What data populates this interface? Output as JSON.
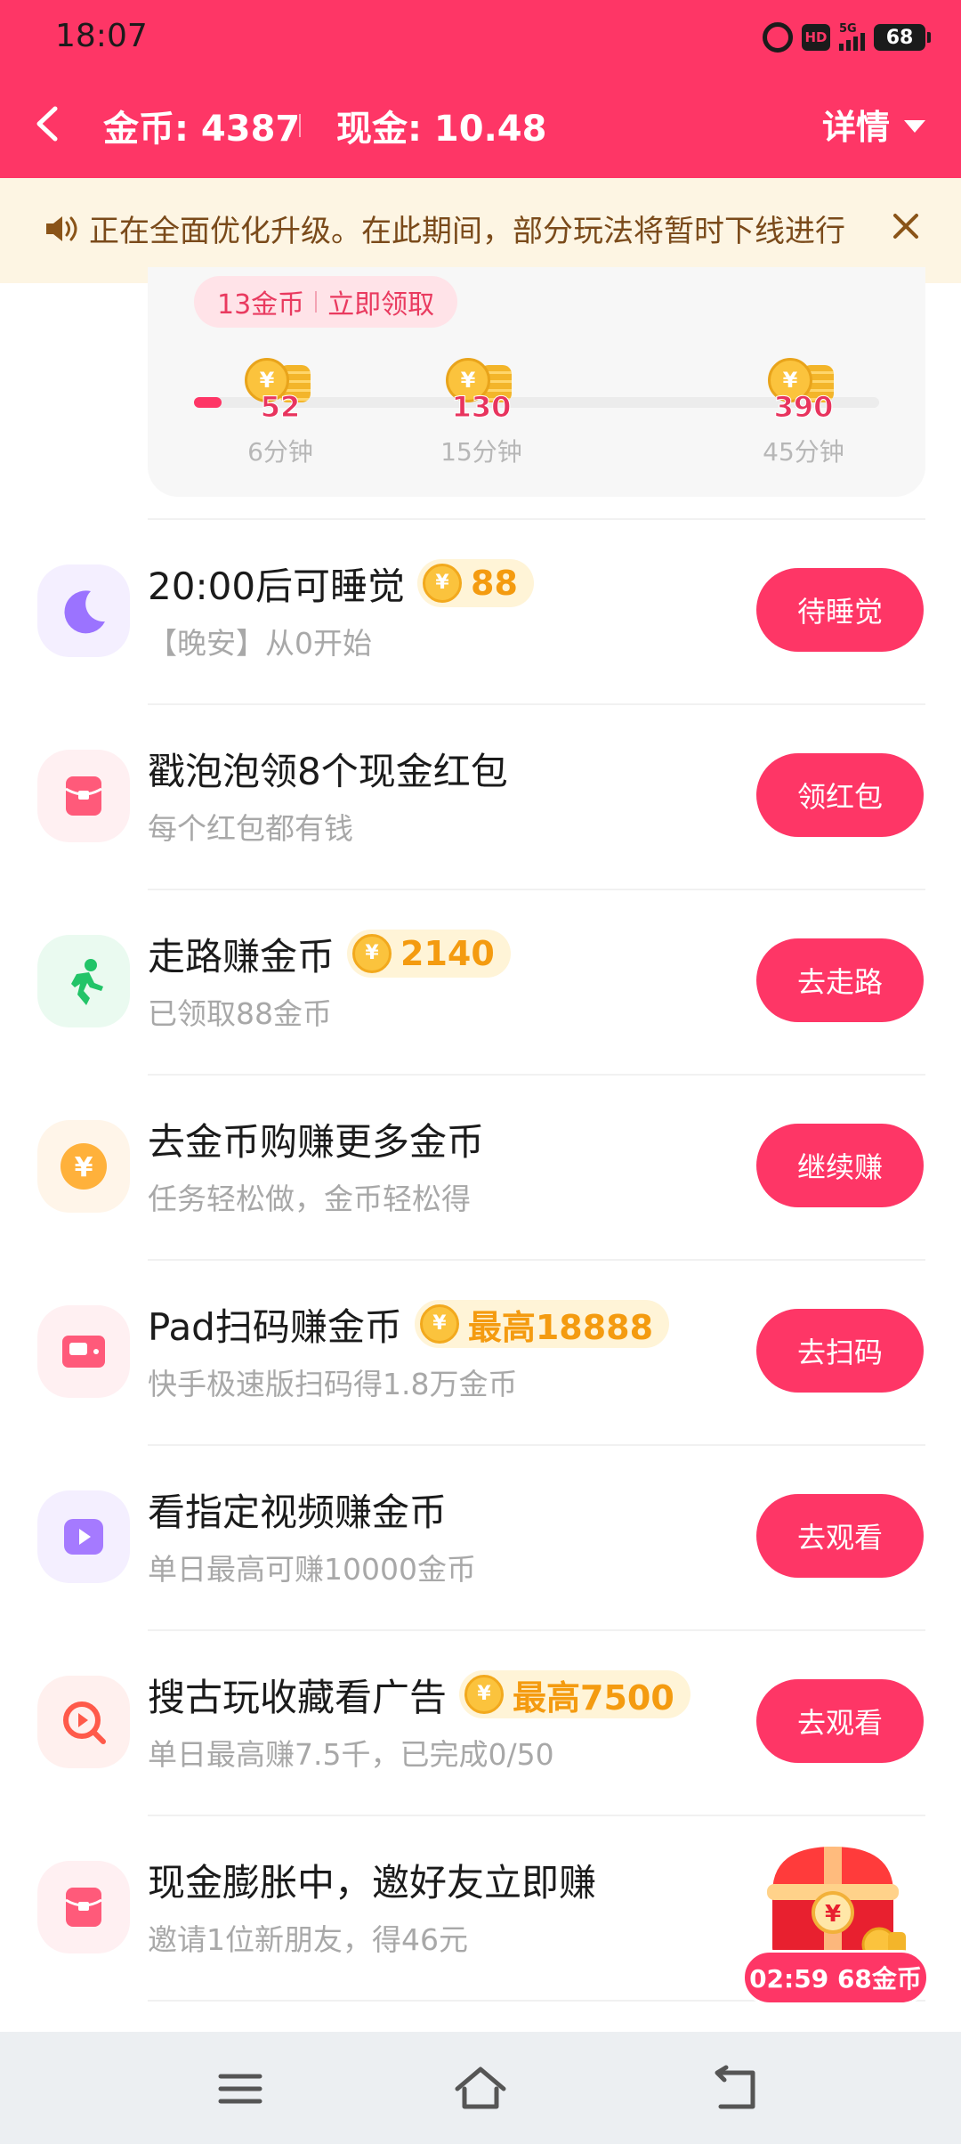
{
  "status_bar": {
    "time": "18:07",
    "network": "5G",
    "hd_label": "HD",
    "battery": "68"
  },
  "nav": {
    "coins_label": "金币: 4387",
    "cash_label": "现金: 10.48",
    "details_label": "详情"
  },
  "notice": {
    "text": "正在全面优化升级。在此期间，部分玩法将暂时下线进行"
  },
  "progress_card": {
    "claim_coins": "13金币",
    "claim_action": "立即领取",
    "progress_fraction": 0.04,
    "milestones": [
      {
        "coins": "52",
        "time": "6分钟"
      },
      {
        "coins": "130",
        "time": "15分钟"
      },
      {
        "coins": "390",
        "time": "45分钟"
      }
    ]
  },
  "tasks": [
    {
      "title": "20:00后可睡觉",
      "reward": "88",
      "subtitle": "【晚安】从0开始",
      "button": "待睡觉",
      "icon": "moon-icon"
    },
    {
      "title": "戳泡泡领8个现金红包",
      "reward": "",
      "subtitle": "每个红包都有钱",
      "button": "领红包",
      "icon": "red-envelope-icon"
    },
    {
      "title": "走路赚金币",
      "reward": "2140",
      "subtitle": "已领取88金币",
      "button": "去走路",
      "icon": "walking-person-icon"
    },
    {
      "title": "去金币购赚更多金币",
      "reward": "",
      "subtitle": "任务轻松做，金币轻松得",
      "button": "继续赚",
      "icon": "yuan-coin-icon"
    },
    {
      "title": "Pad扫码赚金币",
      "reward": "最高18888",
      "subtitle": "快手极速版扫码得1.8万金币",
      "button": "去扫码",
      "icon": "tablet-icon"
    },
    {
      "title": "看指定视频赚金币",
      "reward": "",
      "subtitle": "单日最高可赚10000金币",
      "button": "去观看",
      "icon": "play-video-icon"
    },
    {
      "title": "搜古玩收藏看广告",
      "reward": "最高7500",
      "subtitle": "单日最高赚7.5千，已完成0/50",
      "button": "去观看",
      "icon": "search-play-icon"
    },
    {
      "title": "现金膨胀中，邀好友立即赚",
      "reward": "",
      "subtitle": "邀请1位新朋友，得46元",
      "button": "",
      "icon": "red-envelope-icon"
    }
  ],
  "promo": {
    "badge": "02:59 68金币"
  },
  "colors": {
    "primary": "#fe3666",
    "notice_bg": "#fdf5e3",
    "reward_gold": "#f49b10"
  }
}
